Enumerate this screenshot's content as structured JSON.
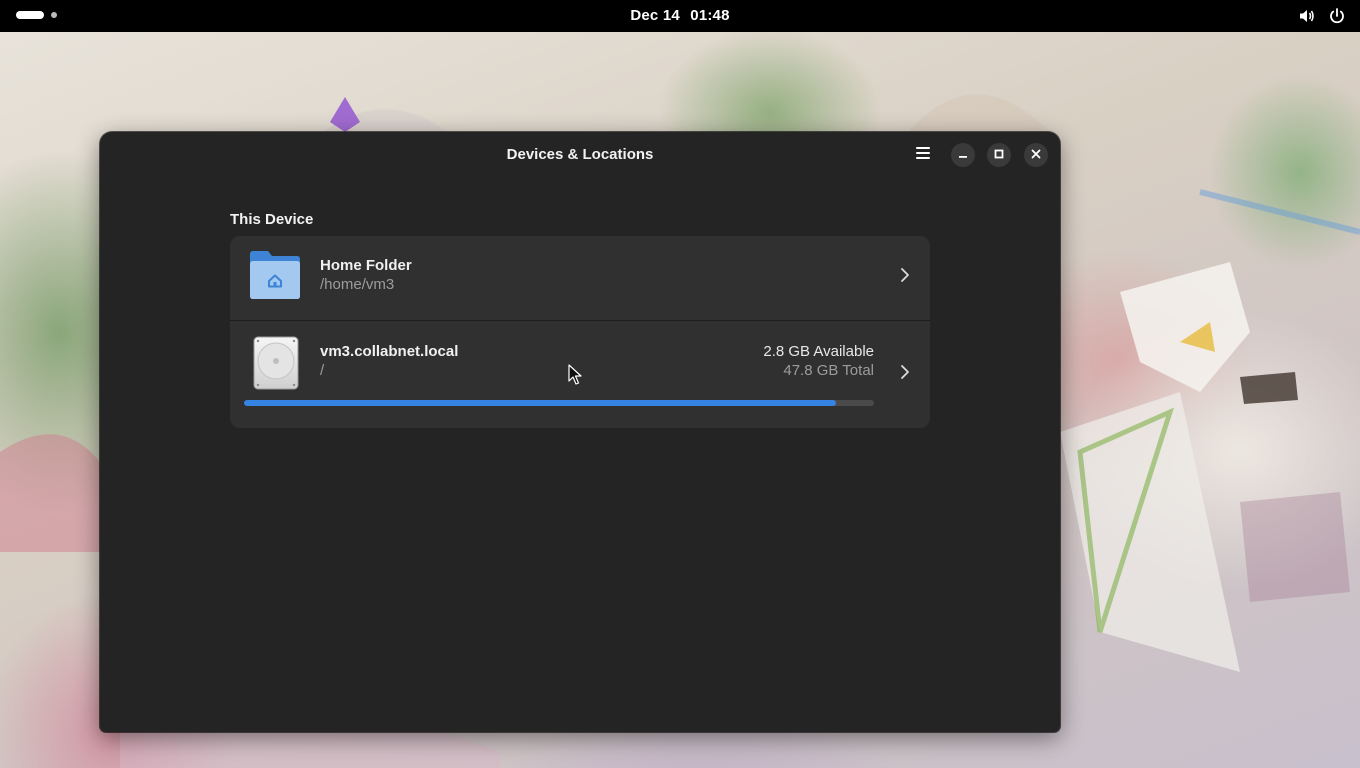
{
  "topbar": {
    "date": "Dec 14",
    "time": "01:48",
    "icons": [
      "activities-indicator",
      "volume-icon",
      "power-icon"
    ]
  },
  "window": {
    "title": "Devices & Locations",
    "controls": [
      "menu-icon",
      "minimize-icon",
      "maximize-icon",
      "close-icon"
    ]
  },
  "section": {
    "title": "This Device"
  },
  "locations": [
    {
      "name": "Home Folder",
      "path": "/home/vm3",
      "icon": "folder-home-icon"
    },
    {
      "name": "vm3.collabnet.local",
      "path": "/",
      "available": "2.8 GB Available",
      "total": "47.8 GB Total",
      "usage_fraction": 0.94,
      "icon": "drive-harddisk-icon"
    }
  ],
  "colors": {
    "accent": "#3584e4",
    "window_bg": "#242424",
    "row_bg": "#303030",
    "topbar_bg": "#000000"
  }
}
